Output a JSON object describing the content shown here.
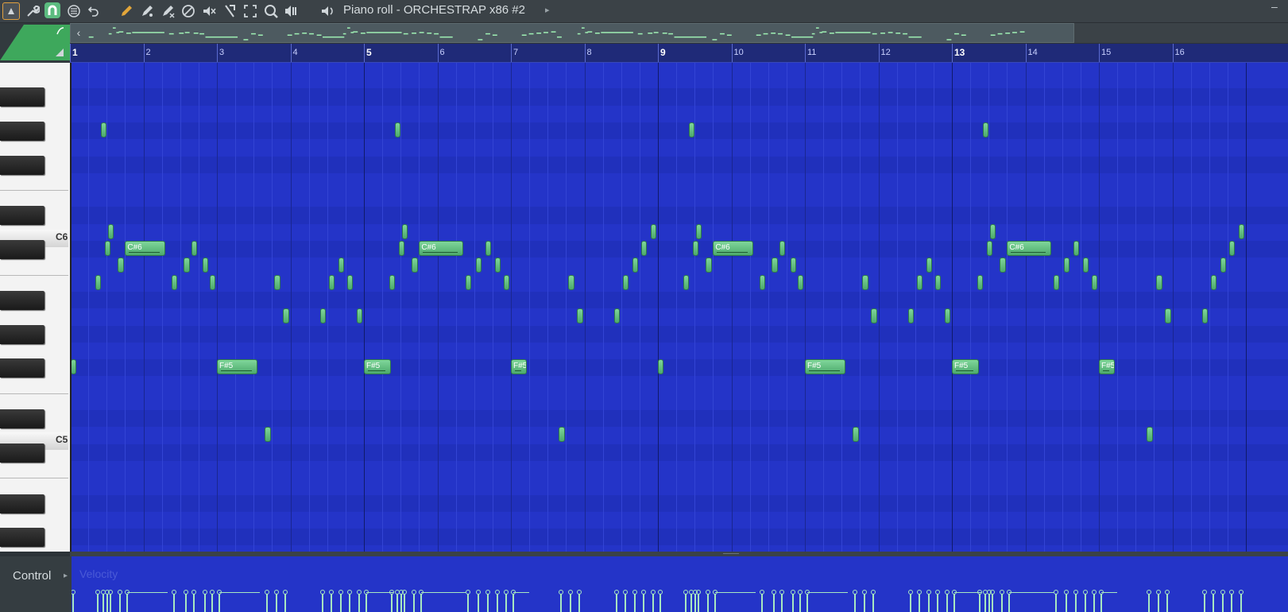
{
  "window": {
    "title": "Piano roll - ORCHESTRAP x86 #2",
    "minimize": "–"
  },
  "toolbar": {
    "icons": [
      "arrow-menu-icon",
      "wrench-icon",
      "magnet-icon",
      "menu-circle-icon",
      "undo-icon",
      "pencil-icon",
      "paint-brush-icon",
      "delete-brush-icon",
      "mute-circle-icon",
      "mute-speaker-icon",
      "slice-icon",
      "select-icon",
      "zoom-icon",
      "playback-icon",
      "speaker-icon"
    ]
  },
  "timeline": {
    "bars": [
      "1",
      "2",
      "3",
      "4",
      "5",
      "6",
      "7",
      "8",
      "9",
      "10",
      "11",
      "12",
      "13",
      "14",
      "15",
      "16"
    ]
  },
  "keyboard": {
    "labels": {
      "c6": "C6",
      "c5": "C5"
    }
  },
  "control": {
    "label": "Control",
    "target": "Velocity"
  },
  "colors": {
    "grid": "#2434c8",
    "note": "#5cb878",
    "timeline": "#1f2a78"
  },
  "notes": [
    {
      "label": "",
      "bar": 1.01,
      "len": 0.08,
      "pitch": "F#5"
    },
    {
      "label": "",
      "bar": 1.35,
      "len": 0.05,
      "pitch": "B5"
    },
    {
      "label": "",
      "bar": 1.42,
      "len": 0.05,
      "pitch": "G#6"
    },
    {
      "label": "",
      "bar": 1.48,
      "len": 0.05,
      "pitch": "C#6"
    },
    {
      "label": "",
      "bar": 1.52,
      "len": 0.08,
      "pitch": "D6"
    },
    {
      "label": "",
      "bar": 1.65,
      "len": 0.08,
      "pitch": "C6"
    },
    {
      "label": "C#6",
      "bar": 1.75,
      "len": 0.55,
      "pitch": "C#6"
    },
    {
      "label": "",
      "bar": 2.38,
      "len": 0.08,
      "pitch": "B5"
    },
    {
      "label": "",
      "bar": 2.55,
      "len": 0.08,
      "pitch": "C6"
    },
    {
      "label": "",
      "bar": 2.65,
      "len": 0.08,
      "pitch": "C#6"
    },
    {
      "label": "",
      "bar": 2.8,
      "len": 0.08,
      "pitch": "C6"
    },
    {
      "label": "",
      "bar": 2.9,
      "len": 0.08,
      "pitch": "B5"
    },
    {
      "label": "F#5",
      "bar": 3.0,
      "len": 0.55,
      "pitch": "F#5"
    },
    {
      "label": "",
      "bar": 3.65,
      "len": 0.08,
      "pitch": "D5"
    },
    {
      "label": "",
      "bar": 3.78,
      "len": 0.08,
      "pitch": "B5"
    },
    {
      "label": "",
      "bar": 3.9,
      "len": 0.08,
      "pitch": "A5"
    },
    {
      "label": "",
      "bar": 4.4,
      "len": 0.08,
      "pitch": "A5"
    },
    {
      "label": "",
      "bar": 4.52,
      "len": 0.08,
      "pitch": "B5"
    },
    {
      "label": "",
      "bar": 4.65,
      "len": 0.08,
      "pitch": "C6"
    },
    {
      "label": "",
      "bar": 4.77,
      "len": 0.08,
      "pitch": "B5"
    },
    {
      "label": "",
      "bar": 4.9,
      "len": 0.08,
      "pitch": "A5"
    },
    {
      "label": "F#5",
      "bar": 5.0,
      "len": 0.37,
      "pitch": "F#5"
    },
    {
      "label": "",
      "bar": 5.35,
      "len": 0.05,
      "pitch": "B5"
    },
    {
      "label": "",
      "bar": 5.42,
      "len": 0.05,
      "pitch": "G#6"
    },
    {
      "label": "",
      "bar": 5.48,
      "len": 0.05,
      "pitch": "C#6"
    },
    {
      "label": "",
      "bar": 5.52,
      "len": 0.08,
      "pitch": "D6"
    },
    {
      "label": "",
      "bar": 5.65,
      "len": 0.08,
      "pitch": "C6"
    },
    {
      "label": "C#6",
      "bar": 5.75,
      "len": 0.6,
      "pitch": "C#6"
    },
    {
      "label": "",
      "bar": 6.38,
      "len": 0.08,
      "pitch": "B5"
    },
    {
      "label": "",
      "bar": 6.52,
      "len": 0.08,
      "pitch": "C6"
    },
    {
      "label": "",
      "bar": 6.65,
      "len": 0.08,
      "pitch": "C#6"
    },
    {
      "label": "",
      "bar": 6.78,
      "len": 0.08,
      "pitch": "C6"
    },
    {
      "label": "",
      "bar": 6.9,
      "len": 0.08,
      "pitch": "B5"
    },
    {
      "label": "F#5",
      "bar": 7.0,
      "len": 0.22,
      "pitch": "F#5"
    },
    {
      "label": "",
      "bar": 7.65,
      "len": 0.08,
      "pitch": "D5"
    },
    {
      "label": "",
      "bar": 7.78,
      "len": 0.08,
      "pitch": "B5"
    },
    {
      "label": "",
      "bar": 7.9,
      "len": 0.08,
      "pitch": "A5"
    },
    {
      "label": "",
      "bar": 8.4,
      "len": 0.08,
      "pitch": "A5"
    },
    {
      "label": "",
      "bar": 8.52,
      "len": 0.08,
      "pitch": "B5"
    },
    {
      "label": "",
      "bar": 8.65,
      "len": 0.08,
      "pitch": "C6"
    },
    {
      "label": "",
      "bar": 8.77,
      "len": 0.08,
      "pitch": "C#6"
    },
    {
      "label": "",
      "bar": 8.9,
      "len": 0.08,
      "pitch": "D6"
    },
    {
      "label": "",
      "bar": 9.0,
      "len": 0.08,
      "pitch": "F#5"
    },
    {
      "label": "",
      "bar": 9.35,
      "len": 0.05,
      "pitch": "B5"
    },
    {
      "label": "",
      "bar": 9.42,
      "len": 0.05,
      "pitch": "G#6"
    },
    {
      "label": "",
      "bar": 9.48,
      "len": 0.05,
      "pitch": "C#6"
    },
    {
      "label": "",
      "bar": 9.52,
      "len": 0.08,
      "pitch": "D6"
    },
    {
      "label": "",
      "bar": 9.65,
      "len": 0.08,
      "pitch": "C6"
    },
    {
      "label": "C#6",
      "bar": 9.75,
      "len": 0.55,
      "pitch": "C#6"
    },
    {
      "label": "",
      "bar": 10.38,
      "len": 0.08,
      "pitch": "B5"
    },
    {
      "label": "",
      "bar": 10.55,
      "len": 0.08,
      "pitch": "C6"
    },
    {
      "label": "",
      "bar": 10.65,
      "len": 0.08,
      "pitch": "C#6"
    },
    {
      "label": "",
      "bar": 10.8,
      "len": 0.08,
      "pitch": "C6"
    },
    {
      "label": "",
      "bar": 10.9,
      "len": 0.08,
      "pitch": "B5"
    },
    {
      "label": "F#5",
      "bar": 11.0,
      "len": 0.55,
      "pitch": "F#5"
    },
    {
      "label": "",
      "bar": 11.65,
      "len": 0.08,
      "pitch": "D5"
    },
    {
      "label": "",
      "bar": 11.78,
      "len": 0.08,
      "pitch": "B5"
    },
    {
      "label": "",
      "bar": 11.9,
      "len": 0.08,
      "pitch": "A5"
    },
    {
      "label": "",
      "bar": 12.4,
      "len": 0.08,
      "pitch": "A5"
    },
    {
      "label": "",
      "bar": 12.52,
      "len": 0.08,
      "pitch": "B5"
    },
    {
      "label": "",
      "bar": 12.65,
      "len": 0.08,
      "pitch": "C6"
    },
    {
      "label": "",
      "bar": 12.77,
      "len": 0.08,
      "pitch": "B5"
    },
    {
      "label": "",
      "bar": 12.9,
      "len": 0.08,
      "pitch": "A5"
    },
    {
      "label": "F#5",
      "bar": 13.0,
      "len": 0.37,
      "pitch": "F#5"
    },
    {
      "label": "",
      "bar": 13.35,
      "len": 0.05,
      "pitch": "B5"
    },
    {
      "label": "",
      "bar": 13.42,
      "len": 0.05,
      "pitch": "G#6"
    },
    {
      "label": "",
      "bar": 13.48,
      "len": 0.05,
      "pitch": "C#6"
    },
    {
      "label": "",
      "bar": 13.52,
      "len": 0.08,
      "pitch": "D6"
    },
    {
      "label": "",
      "bar": 13.65,
      "len": 0.08,
      "pitch": "C6"
    },
    {
      "label": "C#6",
      "bar": 13.75,
      "len": 0.6,
      "pitch": "C#6"
    },
    {
      "label": "",
      "bar": 14.38,
      "len": 0.08,
      "pitch": "B5"
    },
    {
      "label": "",
      "bar": 14.52,
      "len": 0.08,
      "pitch": "C6"
    },
    {
      "label": "",
      "bar": 14.65,
      "len": 0.08,
      "pitch": "C#6"
    },
    {
      "label": "",
      "bar": 14.78,
      "len": 0.08,
      "pitch": "C6"
    },
    {
      "label": "",
      "bar": 14.9,
      "len": 0.08,
      "pitch": "B5"
    },
    {
      "label": "F#5",
      "bar": 15.0,
      "len": 0.22,
      "pitch": "F#5"
    },
    {
      "label": "",
      "bar": 15.65,
      "len": 0.08,
      "pitch": "D5"
    },
    {
      "label": "",
      "bar": 15.78,
      "len": 0.08,
      "pitch": "B5"
    },
    {
      "label": "",
      "bar": 15.9,
      "len": 0.08,
      "pitch": "A5"
    },
    {
      "label": "",
      "bar": 16.4,
      "len": 0.08,
      "pitch": "A5"
    },
    {
      "label": "",
      "bar": 16.52,
      "len": 0.08,
      "pitch": "B5"
    },
    {
      "label": "",
      "bar": 16.65,
      "len": 0.08,
      "pitch": "C6"
    },
    {
      "label": "",
      "bar": 16.77,
      "len": 0.08,
      "pitch": "C#6"
    },
    {
      "label": "",
      "bar": 16.9,
      "len": 0.08,
      "pitch": "D6"
    }
  ]
}
